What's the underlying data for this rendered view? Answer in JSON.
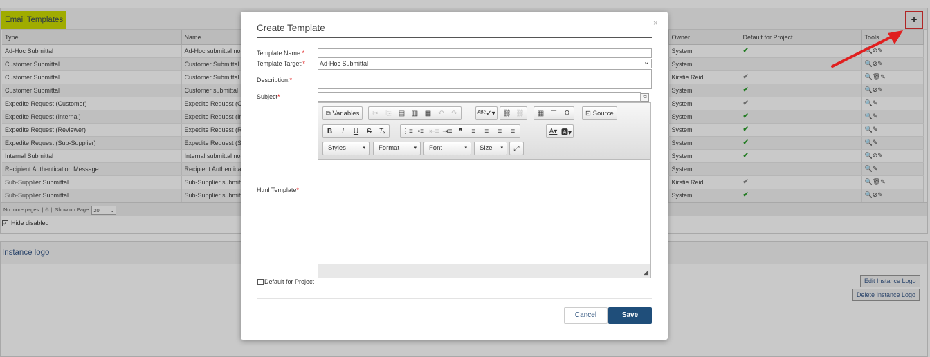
{
  "background": {
    "panel_title": "Email Templates",
    "add_button": "+",
    "columns": [
      "Type",
      "Name",
      "",
      "Owner",
      "Default for Project",
      "Tools"
    ],
    "rows": [
      {
        "type": "Ad-Hoc Submittal",
        "name": "Ad-Hoc submittal no",
        "owner": "System",
        "default": "green",
        "tools": "🔍⊘✎"
      },
      {
        "type": "Customer Submittal",
        "name": "Customer Submittal",
        "owner": "System",
        "default": "",
        "tools": "🔍⊘✎"
      },
      {
        "type": "Customer Submittal",
        "name": "Customer Submittal",
        "owner": "Kirstie Reid",
        "default": "grey",
        "tools": "🔍🗑✎"
      },
      {
        "type": "Customer Submittal",
        "name": "Customer submittal",
        "owner": "System",
        "default": "green",
        "tools": "🔍⊘✎"
      },
      {
        "type": "Expedite Request (Customer)",
        "name": "Expedite Request (Cu",
        "owner": "System",
        "default": "grey",
        "tools": "🔍✎"
      },
      {
        "type": "Expedite Request (Internal)",
        "name": "Expedite Request (Int",
        "owner": "System",
        "default": "green",
        "tools": "🔍✎"
      },
      {
        "type": "Expedite Request (Reviewer)",
        "name": "Expedite Request (Re",
        "owner": "System",
        "default": "green",
        "tools": "🔍✎"
      },
      {
        "type": "Expedite Request (Sub-Supplier)",
        "name": "Expedite Request (Su",
        "owner": "System",
        "default": "green",
        "tools": "🔍✎"
      },
      {
        "type": "Internal Submittal",
        "name": "Internal submittal no",
        "owner": "System",
        "default": "green",
        "tools": "🔍⊘✎"
      },
      {
        "type": "Recipient Authentication Message",
        "name": "Recipient Authentica",
        "owner": "System",
        "default": "",
        "tools": "🔍✎"
      },
      {
        "type": "Sub-Supplier Submittal",
        "name": "Sub-Supplier submitt",
        "owner": "Kirstie Reid",
        "default": "grey",
        "tools": "🔍🗑✎"
      },
      {
        "type": "Sub-Supplier Submittal",
        "name": "Sub-Supplier submitt",
        "owner": "System",
        "default": "green",
        "tools": "🔍⊘✎"
      }
    ],
    "pager": {
      "no_more": "No more pages",
      "show_on_page": "Show on Page:",
      "page_size": "20"
    },
    "hide_disabled": "Hide disabled",
    "instance_logo_title": "Instance logo",
    "edit_logo": "Edit Instance Logo",
    "delete_logo": "Delete Instance Logo"
  },
  "modal": {
    "title": "Create Template",
    "close": "×",
    "template_name_label": "Template Name:",
    "template_target_label": "Template Target:",
    "template_target_value": "Ad-Hoc Submittal",
    "description_label": "Description:",
    "subject_label": "Subject",
    "html_template_label": "Html Template",
    "required_mark": "*",
    "toolbar": {
      "variables": "Variables",
      "source": "Source",
      "styles": "Styles",
      "format": "Format",
      "font": "Font",
      "size": "Size"
    },
    "default_for_project": "Default for Project",
    "cancel": "Cancel",
    "save": "Save"
  },
  "colors": {
    "accent_title_bg": "#ccdb00",
    "save_bg": "#1f4e7a",
    "arrow": "#e02020",
    "check_green": "#2d9e2d"
  }
}
